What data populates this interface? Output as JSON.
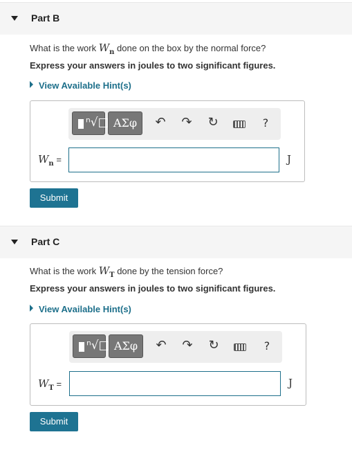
{
  "parts": [
    {
      "title": "Part B",
      "question_before": "What is the work ",
      "var_symbol": "W",
      "var_subscript": "n",
      "question_after": " done on the box by the normal force?",
      "instruction": "Express your answers in joules to two significant figures.",
      "hint_label": "View Available Hint(s)",
      "toolbar": {
        "greek_label": "ΑΣφ",
        "undo_icon": "undo-icon",
        "redo_icon": "redo-icon",
        "reset_icon": "reset-icon",
        "keyboard_icon": "keyboard-icon",
        "help_label": "?"
      },
      "label_symbol": "W",
      "label_subscript": "n",
      "label_equals": " =",
      "input_value": "",
      "unit": "J",
      "submit_label": "Submit"
    },
    {
      "title": "Part C",
      "question_before": "What is the work ",
      "var_symbol": "W",
      "var_subscript": "T",
      "question_after": " done by the tension force?",
      "instruction": "Express your answers in joules to two significant figures.",
      "hint_label": "View Available Hint(s)",
      "toolbar": {
        "greek_label": "ΑΣφ",
        "undo_icon": "undo-icon",
        "redo_icon": "redo-icon",
        "reset_icon": "reset-icon",
        "keyboard_icon": "keyboard-icon",
        "help_label": "?"
      },
      "label_symbol": "W",
      "label_subscript": "T",
      "label_equals": " =",
      "input_value": "",
      "unit": "J",
      "submit_label": "Submit"
    }
  ],
  "colors": {
    "accent": "#1e7392",
    "header_bg": "#f5f5f5",
    "toolbar_btn": "#777777"
  }
}
